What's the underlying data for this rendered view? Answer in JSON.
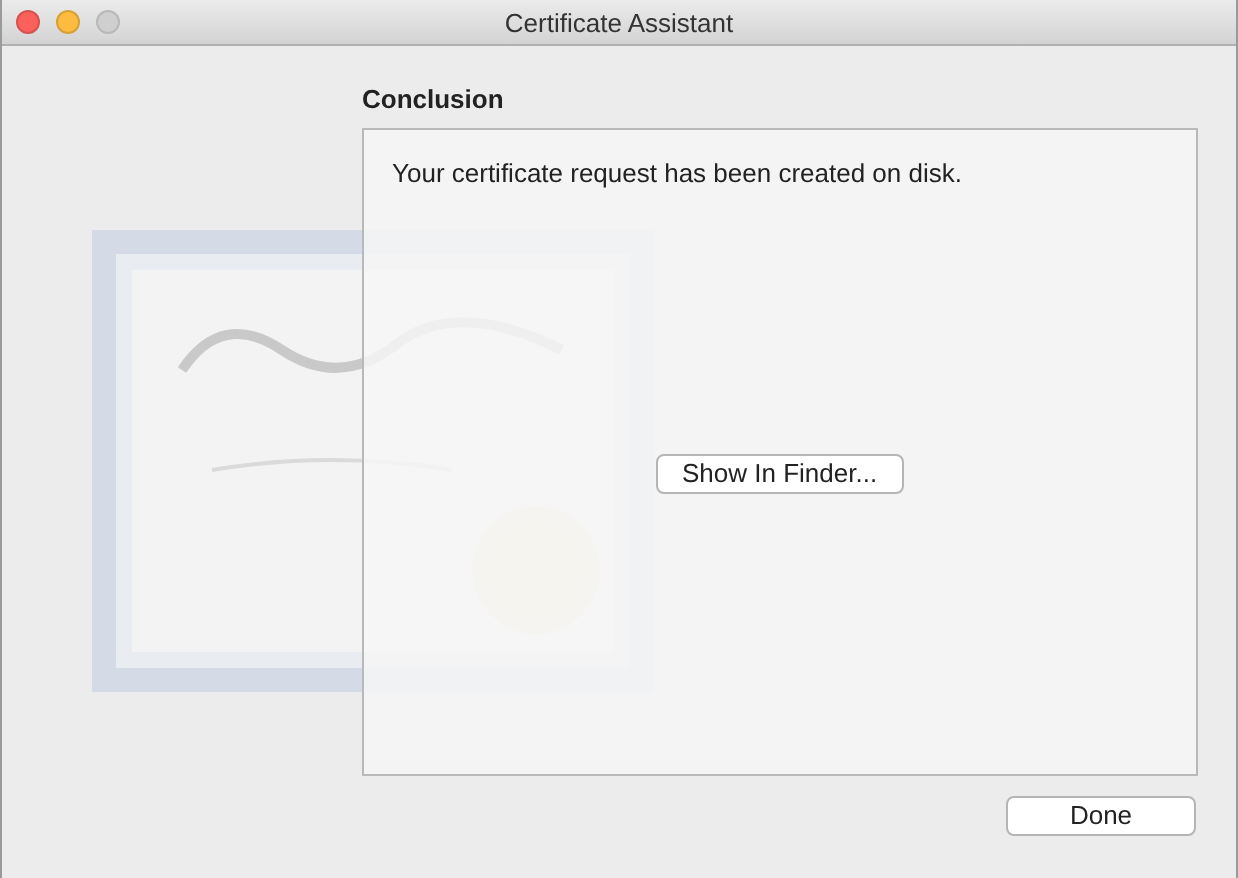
{
  "window": {
    "title": "Certificate Assistant",
    "controls": [
      {
        "kind": "close",
        "disabled": false
      },
      {
        "kind": "minimize",
        "disabled": false
      },
      {
        "kind": "zoom",
        "disabled": true
      }
    ]
  },
  "heading": "Conclusion",
  "panel": {
    "message": "Your certificate request has been created on disk.",
    "button": "Show In Finder..."
  },
  "footer_buttons": [
    "Done"
  ]
}
